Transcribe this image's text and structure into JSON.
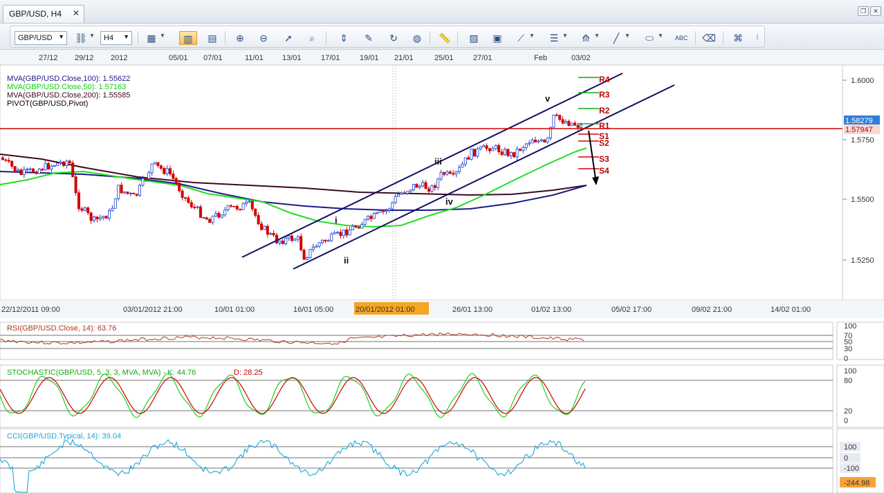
{
  "window": {
    "tab_title": "GBP/USD, H4",
    "tab_close": "✕",
    "restore_icon": "restore-icon",
    "close_icon": "close-icon"
  },
  "toolbar": {
    "symbol": "GBP/USD",
    "timeframe": "H4",
    "icons": [
      "compare-icon",
      "chart-type-icon",
      "candle-icon",
      "bars-icon",
      "zoom-in-icon",
      "zoom-out-icon",
      "cursor-icon",
      "magnify-icon",
      "indicator-icon",
      "edit-icon",
      "refresh-icon",
      "globe-icon",
      "ruler-icon",
      "image-icon",
      "template-icon",
      "trendline-tools-icon",
      "lines-icon",
      "fan-icon",
      "pencil-icon",
      "ellipse-icon",
      "text-icon",
      "eraser-icon",
      "hierarchy-icon",
      "more-icon"
    ]
  },
  "chart": {
    "top_axis_labels": [
      "27/12",
      "29/12",
      "2012",
      "05/01",
      "07/01",
      "11/01",
      "13/01",
      "17/01",
      "19/01",
      "21/01",
      "25/01",
      "27/01",
      "Feb",
      "03/02"
    ],
    "bottom_axis_labels": [
      "22/12/2011 09:00",
      "03/01/2012 21:00",
      "10/01 01:00",
      "16/01 05:00",
      "20/01/2012 01:00",
      "26/01 13:00",
      "01/02 13:00",
      "05/02 17:00",
      "09/02 21:00",
      "14/02 01:00"
    ],
    "highlighted_time": "20/01/2012 01:00",
    "price_labels": [
      "1.6000",
      "1.5750",
      "1.5500",
      "1.5250"
    ],
    "current_price": "1.58279",
    "line_price": "1.57947",
    "legend": [
      {
        "text": "MVA(GBP/USD.Close,100): 1.55622",
        "color": "#1a1a8c"
      },
      {
        "text": "MVA(GBP/USD.Close,50): 1.57163",
        "color": "#11cc11"
      },
      {
        "text": "MVA(GBP/USD.Close,200): 1.55585",
        "color": "#3a0a20"
      },
      {
        "text": "PIVOT(GBP/USD,Pivot)",
        "color": "#000000"
      }
    ],
    "pivots": [
      "R4",
      "R3",
      "R2",
      "R1",
      "S1",
      "S2",
      "S3",
      "S4"
    ],
    "waves": [
      "i",
      "ii",
      "iii",
      "iv",
      "v"
    ]
  },
  "rsi": {
    "title": "RSI(GBP/USD.Close, 14): 63.76",
    "levels": [
      "100",
      "70",
      "50",
      "30",
      "0"
    ],
    "color": "#b03a1a"
  },
  "stoch": {
    "title_main": "STOCHASTIC(GBP/USD, 5, 3, 3, MVA, MVA) -  K: 44.76",
    "title_d": "D: 28.25",
    "levels": [
      "100",
      "80",
      "20",
      "0"
    ]
  },
  "cci": {
    "title": "CCI(GBP/USD.Typical, 14): 39.04",
    "levels": [
      "100",
      "0",
      "-100"
    ],
    "current": "-244.98",
    "color": "#1aa7d8"
  }
}
